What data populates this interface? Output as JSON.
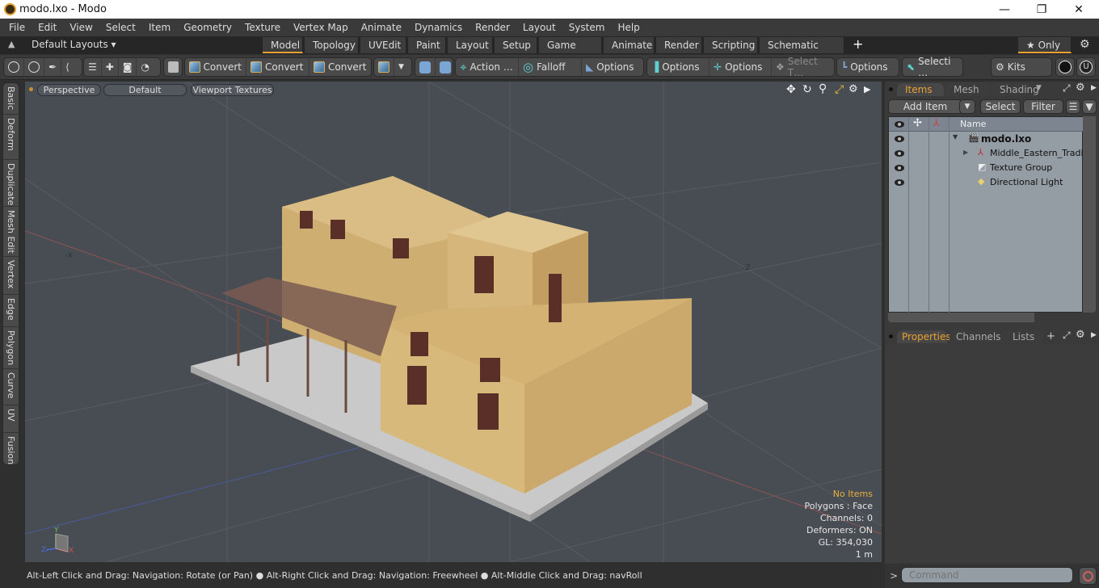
{
  "window": {
    "title": "modo.lxo - Modo",
    "minimize": "—",
    "maximize": "❐",
    "close": "✕"
  },
  "menu": [
    "File",
    "Edit",
    "View",
    "Select",
    "Item",
    "Geometry",
    "Texture",
    "Vertex Map",
    "Animate",
    "Dynamics",
    "Render",
    "Layout",
    "System",
    "Help"
  ],
  "layoutbar": {
    "layouts_label": "Default Layouts ▾",
    "tabs": [
      "Model",
      "Topology",
      "UVEdit",
      "Paint",
      "Layout",
      "Setup",
      "Game Tools",
      "Animate",
      "Render",
      "Scripting",
      "Schematic Fusion"
    ],
    "active_tab": "Model",
    "add_tab": "+",
    "only_label": "★ Only"
  },
  "toolbar": {
    "convert1": "Convert",
    "convert2": "Convert",
    "convert3": "Convert",
    "action": "Action  …",
    "falloff": "Falloff",
    "options1": "Options",
    "options2": "Options",
    "options3": "Options",
    "select_t": "Select T…",
    "options4": "Options",
    "selecti": "Selecti …",
    "kits": "Kits"
  },
  "lefttabs": [
    "Basic",
    "Deform",
    "Duplicate",
    "Mesh Edit",
    "Vertex",
    "Edge",
    "Polygon",
    "Curve",
    "UV",
    "Fusion"
  ],
  "viewport": {
    "view_type": "Perspective",
    "shading": "Default",
    "textures": "Viewport Textures",
    "axis_neg_x": "-X",
    "axis_neg_z": "-Z",
    "info": {
      "selection": "No Items",
      "polygons": "Polygons : Face",
      "channels": "Channels: 0",
      "deformers": "Deformers: ON",
      "gl": "GL: 354,030",
      "scale": "1 m"
    },
    "gizmo": {
      "y": "Y",
      "z": "Z",
      "x": "X"
    }
  },
  "rightpanel": {
    "tabs": [
      "Items",
      "Mesh …",
      "Shading"
    ],
    "active_tab": "Items",
    "add_item": "Add Item",
    "select": "Select",
    "filter": "Filter",
    "column_name": "Name",
    "items": [
      {
        "name": "modo.lxo",
        "level": 0,
        "bold": true,
        "expanded": true
      },
      {
        "name": "Middle_Eastern_Tradi…",
        "level": 1,
        "bold": false,
        "expandable": true
      },
      {
        "name": "Texture Group",
        "level": 1,
        "bold": false
      },
      {
        "name": "Directional Light",
        "level": 1,
        "bold": false
      }
    ],
    "bottom_tabs": [
      "Properties",
      "Channels",
      "Lists"
    ],
    "bottom_active": "Properties",
    "bottom_add": "+"
  },
  "statusbar": {
    "hint1": "Alt-Left Click and Drag: Navigation: Rotate (or Pan)",
    "hint2": "Alt-Right Click and Drag: Navigation: Freewheel",
    "hint3": "Alt-Middle Click and Drag: navRoll"
  },
  "command": {
    "prompt": ">",
    "placeholder": "Command"
  }
}
